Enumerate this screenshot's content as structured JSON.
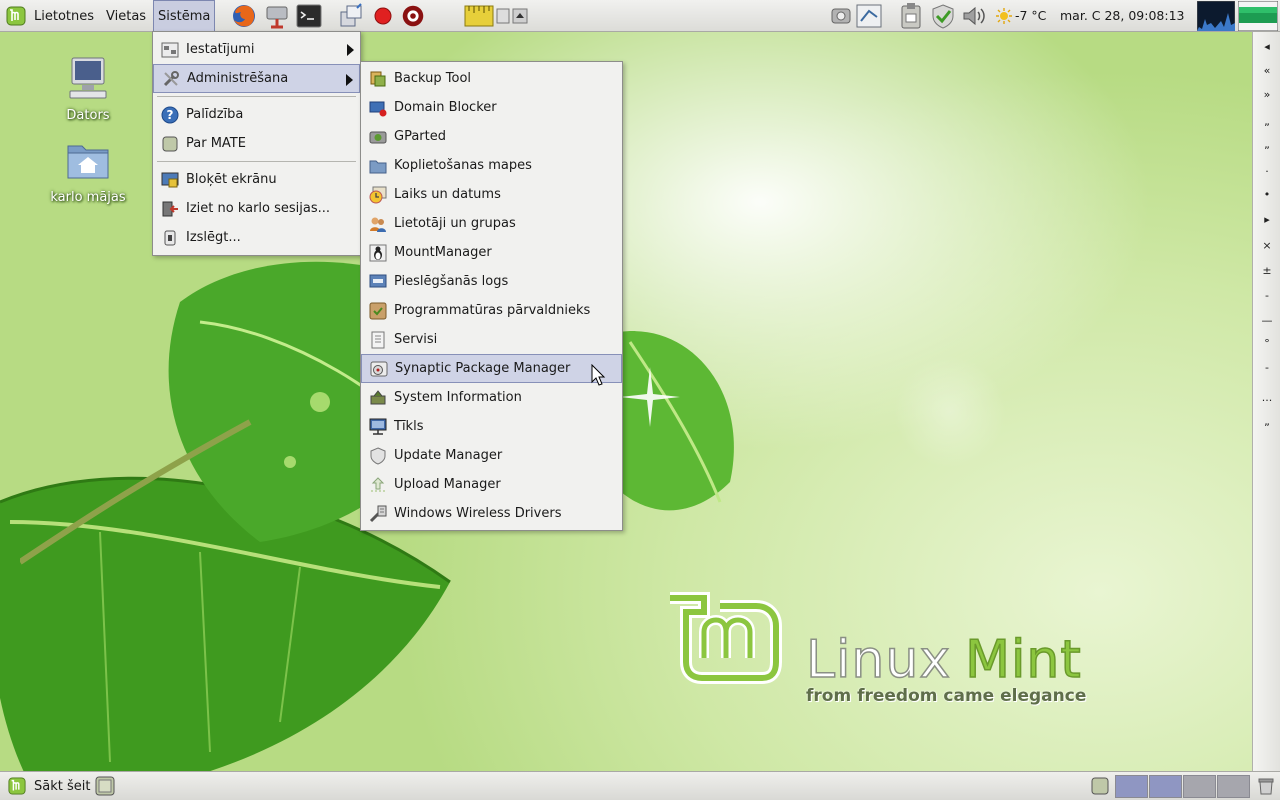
{
  "top_panel": {
    "menus": {
      "applications": "Lietotnes",
      "places": "Vietas",
      "system": "Sistēma"
    },
    "weather": "-7 °C",
    "clock": "mar. C  28, 09:08:13"
  },
  "desktop": {
    "icons": [
      {
        "label": "Dators",
        "icon": "computer-icon"
      },
      {
        "label": "karlo mājas",
        "icon": "home-folder-icon"
      }
    ],
    "logo_title_1": "Linux",
    "logo_title_2": "Mint",
    "logo_tagline": "from freedom came elegance"
  },
  "system_menu": {
    "items": [
      {
        "label": "Iestatījumi",
        "icon": "preferences-icon",
        "submenu": true
      },
      {
        "label": "Administrēšana",
        "icon": "tools-icon",
        "submenu": true
      },
      {
        "label": "Palīdzība",
        "icon": "help-icon"
      },
      {
        "label": "Par MATE",
        "icon": "mate-icon"
      },
      {
        "label": "Bloķēt ekrānu",
        "icon": "lock-screen-icon"
      },
      {
        "label": "Iziet no karlo sesijas...",
        "icon": "logout-icon"
      },
      {
        "label": "Izslēgt...",
        "icon": "shutdown-icon"
      }
    ]
  },
  "admin_submenu": {
    "items": [
      {
        "label": "Backup Tool",
        "icon": "backup-icon"
      },
      {
        "label": "Domain Blocker",
        "icon": "domain-blocker-icon"
      },
      {
        "label": "GParted",
        "icon": "gparted-icon"
      },
      {
        "label": "Koplietošanas mapes",
        "icon": "shared-folders-icon"
      },
      {
        "label": "Laiks un datums",
        "icon": "clock-icon"
      },
      {
        "label": "Lietotāji un grupas",
        "icon": "users-icon"
      },
      {
        "label": "MountManager",
        "icon": "mountmanager-icon"
      },
      {
        "label": "Pieslēgšanās logs",
        "icon": "login-window-icon"
      },
      {
        "label": "Programmatūras pārvaldnieks",
        "icon": "software-manager-icon"
      },
      {
        "label": "Servisi",
        "icon": "services-icon"
      },
      {
        "label": "Synaptic Package Manager",
        "icon": "synaptic-icon"
      },
      {
        "label": "System Information",
        "icon": "system-info-icon"
      },
      {
        "label": "Tīkls",
        "icon": "network-icon"
      },
      {
        "label": "Update Manager",
        "icon": "shield-icon"
      },
      {
        "label": "Upload Manager",
        "icon": "upload-icon"
      },
      {
        "label": "Windows Wireless Drivers",
        "icon": "wireless-drivers-icon"
      }
    ]
  },
  "right_panel": {
    "buttons": [
      "◂",
      "«",
      "»",
      "„",
      "„",
      "·",
      "•",
      "▸",
      "×",
      "±",
      "-",
      "—",
      "°",
      "-",
      "...",
      "„"
    ]
  },
  "bottom_panel": {
    "show_desktop_label": "Sākt šeit"
  },
  "colors": {
    "menu_highlight": "#cfd3e6",
    "mint_green": "#8cc63f",
    "panel_bg": "#e6e6e2"
  }
}
